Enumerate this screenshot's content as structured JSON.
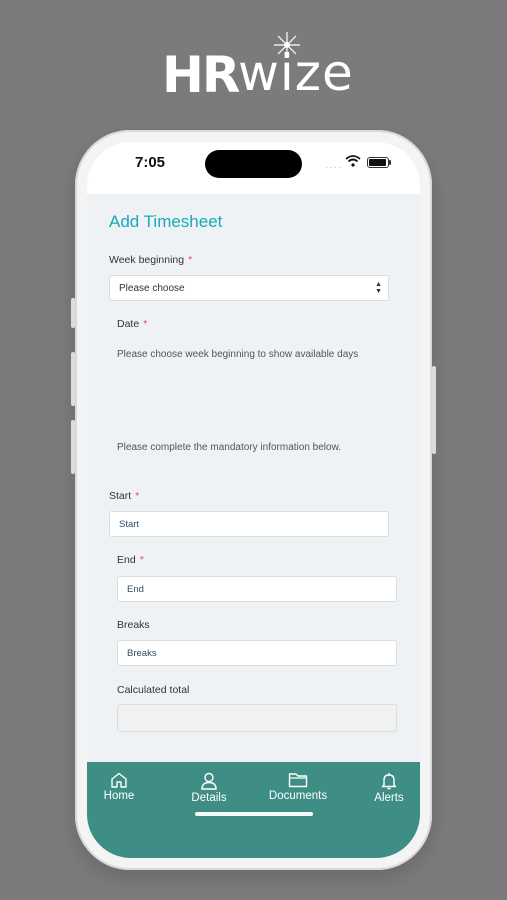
{
  "brand": {
    "logo_text_hr": "HR",
    "logo_text_wize": "wize"
  },
  "status_bar": {
    "time": "7:05"
  },
  "page": {
    "title": "Add Timesheet"
  },
  "week_beginning": {
    "label": "Week beginning",
    "required_marker": "*",
    "selected_option": "Please choose"
  },
  "date": {
    "label": "Date",
    "required_marker": "*",
    "hint": "Please choose week beginning to show available days"
  },
  "mandatory_notice": "Please complete the mandatory information below.",
  "start": {
    "label": "Start",
    "required_marker": "*",
    "value": "Start"
  },
  "end": {
    "label": "End",
    "required_marker": "*",
    "value": "End"
  },
  "breaks": {
    "label": "Breaks",
    "value": "Breaks"
  },
  "calculated_total": {
    "label": "Calculated total",
    "value": ""
  },
  "tabs": [
    {
      "label": "Home",
      "icon": "home-icon"
    },
    {
      "label": "Details",
      "icon": "user-icon"
    },
    {
      "label": "Documents",
      "icon": "folder-icon"
    },
    {
      "label": "Alerts",
      "icon": "bell-icon"
    }
  ],
  "colors": {
    "accent": "#19a9b9",
    "tabbar": "#3e8e85",
    "required": "#d9534f",
    "button_green": "#3aa35a",
    "button_red": "#d9534f"
  }
}
